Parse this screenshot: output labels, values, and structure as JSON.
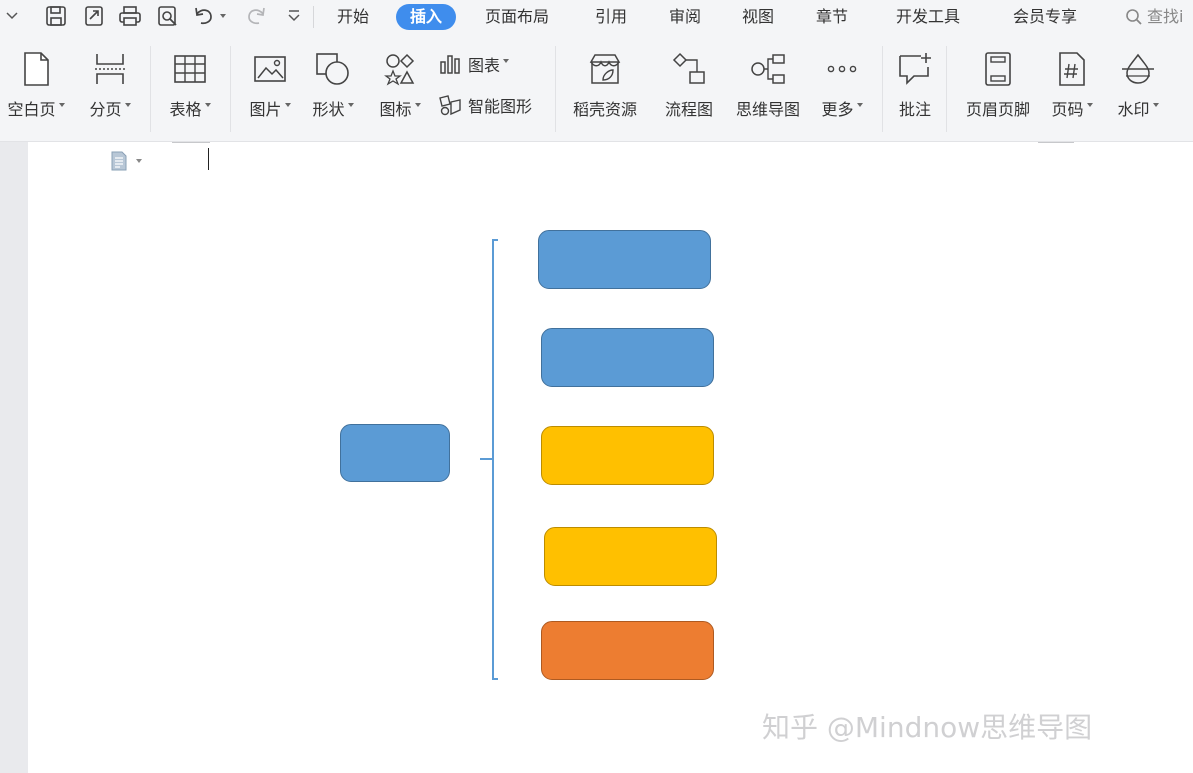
{
  "quick_access": {
    "icons": [
      "chevron-down-icon",
      "save-icon",
      "export-icon",
      "print-icon",
      "print-preview-icon",
      "undo-icon",
      "redo-icon",
      "customize-icon"
    ]
  },
  "menu_tabs": [
    "开始",
    "插入",
    "页面布局",
    "引用",
    "审阅",
    "视图",
    "章节",
    "开发工具",
    "会员专享"
  ],
  "active_tab": "插入",
  "search": {
    "label": "查找i"
  },
  "ribbon": {
    "blank_page": "空白页",
    "page_break": "分页",
    "table": "表格",
    "picture": "图片",
    "shape": "形状",
    "icons": "图标",
    "chart": "图表",
    "smart_art": "智能图形",
    "docer_resources": "稻壳资源",
    "flowchart": "流程图",
    "mind_map": "思维导图",
    "more": "更多",
    "comment": "批注",
    "header_footer": "页眉页脚",
    "page_number": "页码",
    "watermark": "水印"
  },
  "document": {
    "diagram": {
      "colors": {
        "blue": "#5b9bd5",
        "blue_border": "#41719c",
        "yellow": "#ffc000",
        "yellow_border": "#bc8c00",
        "orange": "#ed7d31",
        "orange_border": "#ae5a21",
        "bracket": "#5b9bd5"
      },
      "nodes": [
        "root",
        "branch-1",
        "branch-2",
        "branch-3",
        "branch-4",
        "branch-5"
      ],
      "node_colors": [
        "blue",
        "blue",
        "blue",
        "yellow",
        "yellow",
        "orange"
      ]
    }
  },
  "watermark_text": "知乎 @Mindnow思维导图",
  "accent": "#3f8ded"
}
